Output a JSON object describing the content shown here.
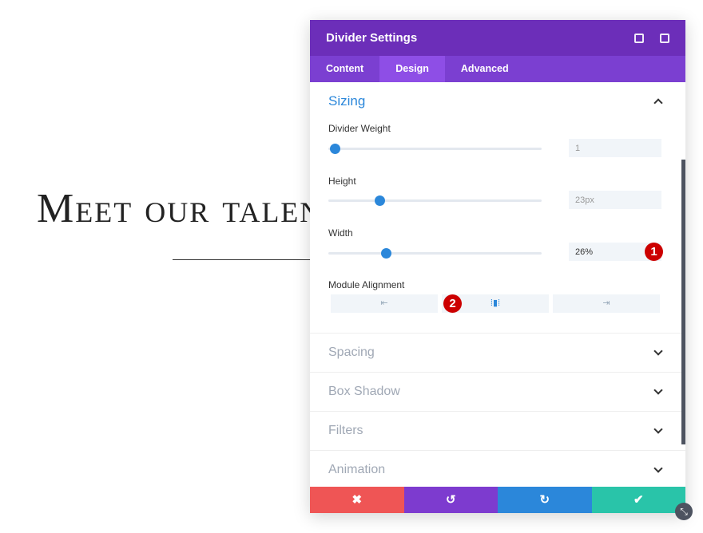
{
  "page": {
    "heading": "Meet our talent"
  },
  "panel": {
    "title": "Divider Settings",
    "tabs": [
      {
        "label": "Content"
      },
      {
        "label": "Design",
        "active": true
      },
      {
        "label": "Advanced"
      }
    ],
    "sizing": {
      "title": "Sizing",
      "fields": [
        {
          "label": "Divider Weight",
          "value": "1",
          "slider_percent": 3
        },
        {
          "label": "Height",
          "value": "23px",
          "slider_percent": 24
        },
        {
          "label": "Width",
          "value": "26%",
          "slider_percent": 27
        }
      ],
      "alignment_label": "Module Alignment",
      "alignment_options": [
        "left",
        "center",
        "right"
      ],
      "alignment_selected": "center"
    },
    "sections": [
      {
        "title": "Spacing"
      },
      {
        "title": "Box Shadow"
      },
      {
        "title": "Filters"
      },
      {
        "title": "Animation"
      }
    ],
    "footer": {
      "cancel": "✖",
      "undo": "↺",
      "redo": "↻",
      "save": "✔"
    },
    "colors": {
      "header": "#6c2eb9",
      "tabs": "#7b3fd1",
      "accent": "#2b87da",
      "cancel": "#ef5555",
      "undo": "#7d3bcf",
      "redo": "#2b87da",
      "save": "#29c4a9"
    }
  },
  "annotations": [
    "1",
    "2"
  ]
}
